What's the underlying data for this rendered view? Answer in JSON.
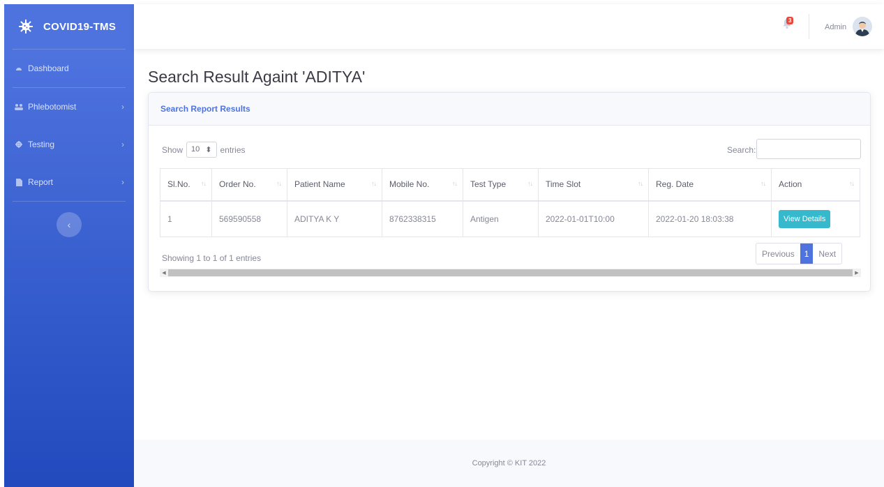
{
  "sidebar": {
    "brand": "COVID19-TMS",
    "items": [
      {
        "label": "Dashboard",
        "icon": "tachometer-icon"
      },
      {
        "label": "Phlebotomist",
        "icon": "users-icon"
      },
      {
        "label": "Testing",
        "icon": "cog-icon"
      },
      {
        "label": "Report",
        "icon": "file-icon"
      }
    ]
  },
  "topbar": {
    "notification_count": "3",
    "user_name": "Admin"
  },
  "page": {
    "title": "Search Result Againt 'ADITYA'"
  },
  "card": {
    "header": "Search Report Results",
    "show_label": "Show",
    "entries_value": "10",
    "entries_label": "entries",
    "search_label": "Search:",
    "search_value": "",
    "columns": [
      "Sl.No.",
      "Order No.",
      "Patient Name",
      "Mobile No.",
      "Test Type",
      "Time Slot",
      "Reg. Date",
      "Action"
    ],
    "rows": [
      {
        "sl": "1",
        "order": "569590558",
        "patient": "ADITYA K Y",
        "mobile": "8762338315",
        "test_type": "Antigen",
        "time_slot": "2022-01-01T10:00",
        "reg_date": "2022-01-20 18:03:38",
        "action": "View Details"
      }
    ],
    "info": "Showing 1 to 1 of 1 entries",
    "pagination": {
      "previous": "Previous",
      "current": "1",
      "next": "Next"
    }
  },
  "footer": {
    "copyright": "Copyright © KIT 2022"
  },
  "colors": {
    "primary": "#4e73df",
    "info": "#36b9cc",
    "danger": "#e74a3b"
  }
}
